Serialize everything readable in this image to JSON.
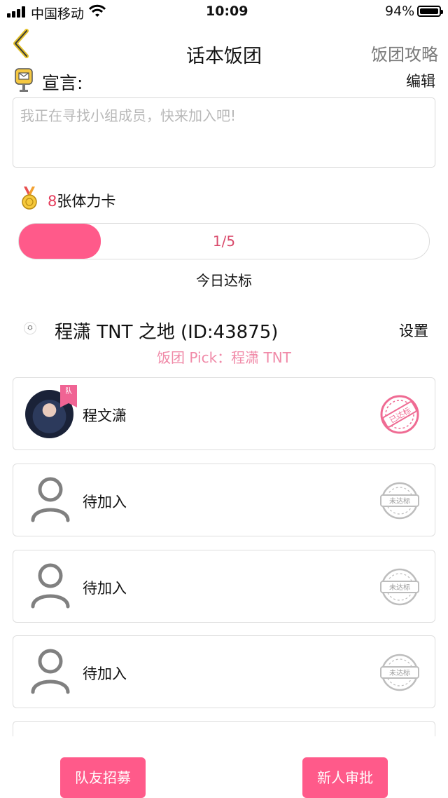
{
  "status_bar": {
    "carrier": "中国移动",
    "time": "10:09",
    "battery": "94%"
  },
  "nav": {
    "title": "话本饭团",
    "guide_link": "饭团攻略",
    "back_icon": "chevron-left-icon"
  },
  "manifesto": {
    "label": "宣言:",
    "edit_label": "编辑",
    "placeholder": "我正在寻找小组成员，快来加入吧!"
  },
  "stamina": {
    "count": "8",
    "unit_label": "张体力卡"
  },
  "progress": {
    "text": "1/5",
    "fraction": 0.2,
    "caption": "今日达标",
    "color": "#ff5a8a"
  },
  "group": {
    "title": "程潇 TNT 之地 (ID:43875)",
    "settings_label": "设置",
    "pick": "饭团 Pick：程潇 TNT"
  },
  "members": [
    {
      "name": "程文潇",
      "badge": "队",
      "status": "已达标",
      "has_photo": true
    },
    {
      "name": "待加入",
      "status": "未达标",
      "has_photo": false
    },
    {
      "name": "待加入",
      "status": "未达标",
      "has_photo": false
    },
    {
      "name": "待加入",
      "status": "未达标",
      "has_photo": false
    }
  ],
  "buttons": {
    "recruit": "队友招募",
    "approve": "新人审批"
  }
}
